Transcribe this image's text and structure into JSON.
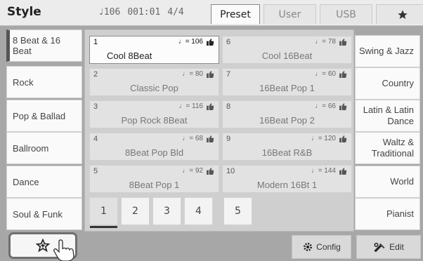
{
  "header": {
    "title": "Style",
    "tempo": "♩106",
    "position": "001:01",
    "meter": "4/4",
    "tabs": [
      {
        "label": "Preset",
        "active": true
      },
      {
        "label": "User",
        "active": false
      },
      {
        "label": "USB",
        "active": false
      },
      {
        "label": "",
        "icon": "star-icon",
        "active": false
      }
    ]
  },
  "left_categories": [
    {
      "label": "8 Beat & 16 Beat",
      "selected": true
    },
    {
      "label": "Rock"
    },
    {
      "label": "Pop & Ballad"
    },
    {
      "label": "Ballroom"
    },
    {
      "label": "Dance"
    },
    {
      "label": "Soul & Funk"
    }
  ],
  "right_categories": [
    {
      "label": "Swing & Jazz"
    },
    {
      "label": "Country"
    },
    {
      "label": "Latin & Latin Dance"
    },
    {
      "label": "Waltz & Traditional"
    },
    {
      "label": "World"
    },
    {
      "label": "Pianist"
    }
  ],
  "styles": [
    {
      "num": "1",
      "tempo": "♩= 106",
      "name": "Cool 8Beat",
      "selected": true
    },
    {
      "num": "6",
      "tempo": "♩= 78",
      "name": "Cool 16Beat"
    },
    {
      "num": "2",
      "tempo": "♩= 80",
      "name": "Classic Pop"
    },
    {
      "num": "7",
      "tempo": "♩= 60",
      "name": "16Beat Pop 1"
    },
    {
      "num": "3",
      "tempo": "♩= 116",
      "name": "Pop Rock 8Beat"
    },
    {
      "num": "8",
      "tempo": "♩= 66",
      "name": "16Beat Pop 2"
    },
    {
      "num": "4",
      "tempo": "♩= 68",
      "name": "8Beat Pop Bld"
    },
    {
      "num": "9",
      "tempo": "♩= 120",
      "name": "16Beat R&B"
    },
    {
      "num": "5",
      "tempo": "♩= 92",
      "name": "8Beat Pop 1"
    },
    {
      "num": "10",
      "tempo": "♩= 144",
      "name": "Modern 16Bt 1"
    }
  ],
  "pages": [
    "1",
    "2",
    "3",
    "4",
    "5"
  ],
  "active_page": "1",
  "bottom": {
    "config_label": "Config",
    "edit_label": "Edit",
    "favorite_icon": "star-plus-icon"
  }
}
